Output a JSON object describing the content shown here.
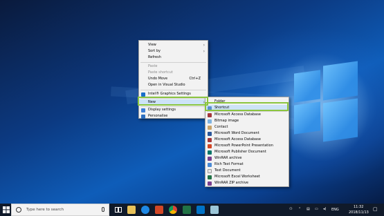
{
  "desktop_menu": {
    "items": [
      {
        "label": "View",
        "submenu": true
      },
      {
        "label": "Sort by",
        "submenu": true
      },
      {
        "label": "Refresh"
      },
      {
        "label": "Paste",
        "disabled": true
      },
      {
        "label": "Paste shortcut",
        "disabled": true
      },
      {
        "label": "Undo Move",
        "shortcut": "Ctrl+Z"
      },
      {
        "label": "Open in Visual Studio"
      },
      {
        "label": "Intel® Graphics Settings"
      },
      {
        "label": "New",
        "submenu": true
      },
      {
        "label": "Display settings"
      },
      {
        "label": "Personalise"
      }
    ]
  },
  "new_menu": {
    "items": [
      {
        "label": "Folder"
      },
      {
        "label": "Shortcut"
      },
      {
        "label": "Microsoft Access Database"
      },
      {
        "label": "Bitmap image"
      },
      {
        "label": "Contact"
      },
      {
        "label": "Microsoft Word Document"
      },
      {
        "label": "Microsoft Access Database"
      },
      {
        "label": "Microsoft PowerPoint Presentation"
      },
      {
        "label": "Microsoft Publisher Document"
      },
      {
        "label": "WinRAR archive"
      },
      {
        "label": "Rich Text Format"
      },
      {
        "label": "Text Document"
      },
      {
        "label": "Microsoft Excel Worksheet"
      },
      {
        "label": "WinRAR ZIP archive"
      }
    ]
  },
  "taskbar": {
    "search_placeholder": "Type here to search",
    "language": "ENG",
    "time": "11:32",
    "date": "2018/11/13"
  },
  "colors": {
    "highlight": "#8bc53f",
    "menu_bg": "#f2f2f2",
    "taskbar_bg": "#101a2a"
  }
}
